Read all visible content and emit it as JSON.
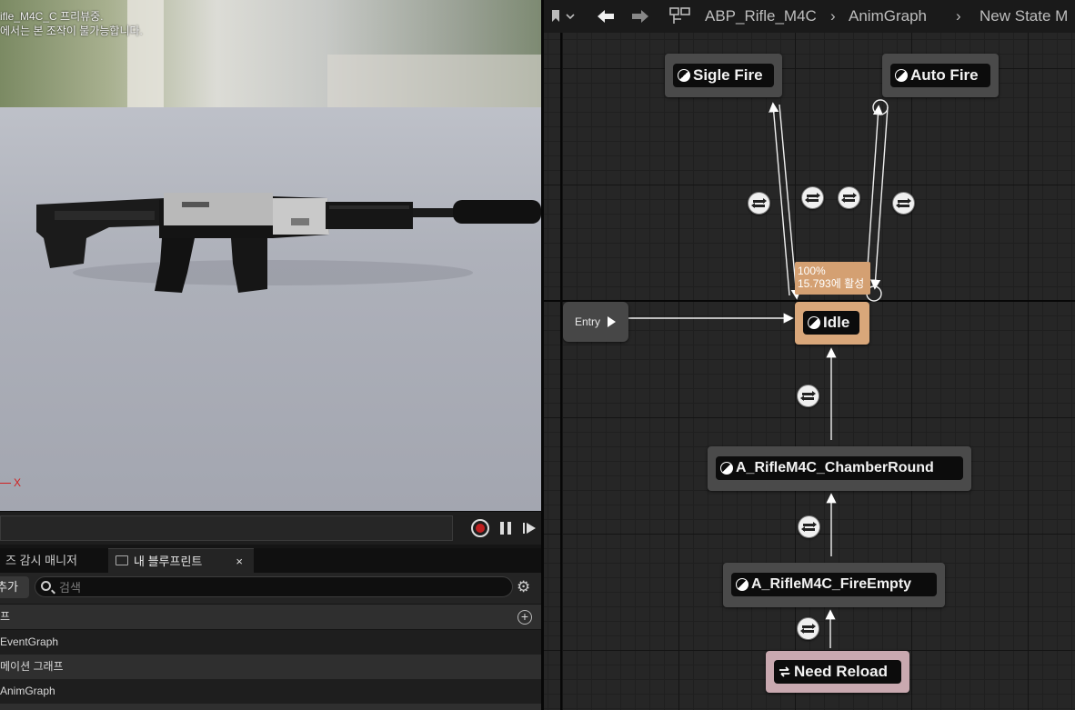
{
  "viewport": {
    "line1": "ifle_M4C_C 프리뷰중.",
    "line2": "에서는 본 조작이 불가능합니다.",
    "axis_x_label": "X"
  },
  "timeline": {
    "record_icon": "record-icon",
    "pause_icon": "pause-icon",
    "play_icon": "play-icon"
  },
  "tabs": {
    "tab1_label": "즈 감시 매니저",
    "tab2_label": "내 블루프린트",
    "tab2_close": "×"
  },
  "my_blueprint": {
    "add_label": "추가",
    "search_placeholder": "검색",
    "rows": [
      {
        "label": "프",
        "kind": "header"
      },
      {
        "label": "EventGraph",
        "kind": "item"
      },
      {
        "label": "메이션 그래프",
        "kind": "header"
      },
      {
        "label": "AnimGraph",
        "kind": "item"
      }
    ]
  },
  "breadcrumb": {
    "asset": "ABP_Rifle_M4C",
    "graph": "AnimGraph",
    "state_machine": "New State M"
  },
  "graph": {
    "entry_label": "Entry",
    "states": {
      "single_fire": "Sigle Fire",
      "auto_fire": "Auto Fire",
      "idle": "Idle",
      "chamber_round": "A_RifleM4C_ChamberRound",
      "fire_empty": "A_RifleM4C_FireEmpty",
      "need_reload": "Need Reload"
    },
    "idle_tooltip": {
      "weight": "100%",
      "active_time": "15.793에 활성"
    }
  },
  "colors": {
    "active_state": "#d9a77a",
    "conduit_state": "#c9a9b0",
    "state_body": "#4a4a4a",
    "graph_background": "#262626"
  }
}
